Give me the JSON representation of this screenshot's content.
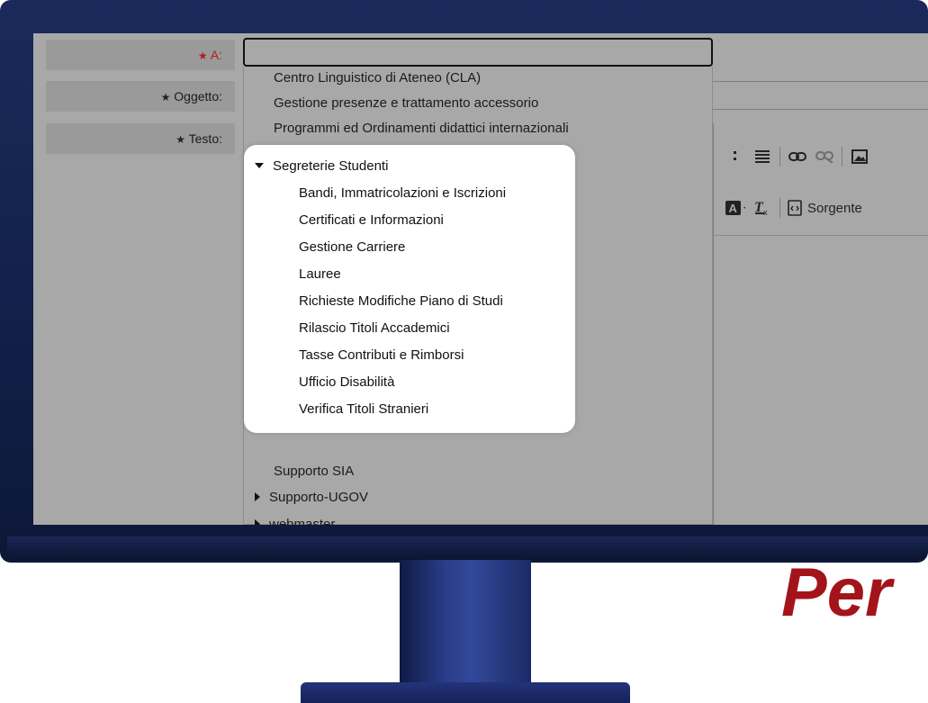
{
  "form": {
    "to_label": "A:",
    "subject_label": "Oggetto:",
    "text_label": "Testo:",
    "star": "★"
  },
  "toolbar": {
    "source_label": "Sorgente"
  },
  "tree": {
    "top_items": [
      "Centro Linguistico di Ateneo (CLA)",
      "Gestione presenze e trattamento accessorio",
      "Programmi ed Ordinamenti didattici internazionali"
    ],
    "expanded_group": {
      "label": "Segreterie Studenti",
      "children": [
        "Bandi, Immatricolazioni e Iscrizioni",
        "Certificati e Informazioni",
        "Gestione Carriere",
        "Lauree",
        "Richieste Modifiche Piano di Studi",
        "Rilascio Titoli Accademici",
        "Tasse Contributi e Rimborsi",
        "Ufficio Disabilità",
        "Verifica Titoli Stranieri"
      ]
    },
    "bottom_items": [
      {
        "label": "Supporto SIA",
        "collapsible": false
      },
      {
        "label": "Supporto-UGOV",
        "collapsible": true
      },
      {
        "label": "webmaster",
        "collapsible": true
      }
    ]
  },
  "brand": {
    "text": "Per",
    "color": "#a3141a"
  },
  "colors": {
    "dim_overlay": "#a8a8a8",
    "monitor_frame": "#12204a",
    "required_red": "#b31b1b"
  }
}
